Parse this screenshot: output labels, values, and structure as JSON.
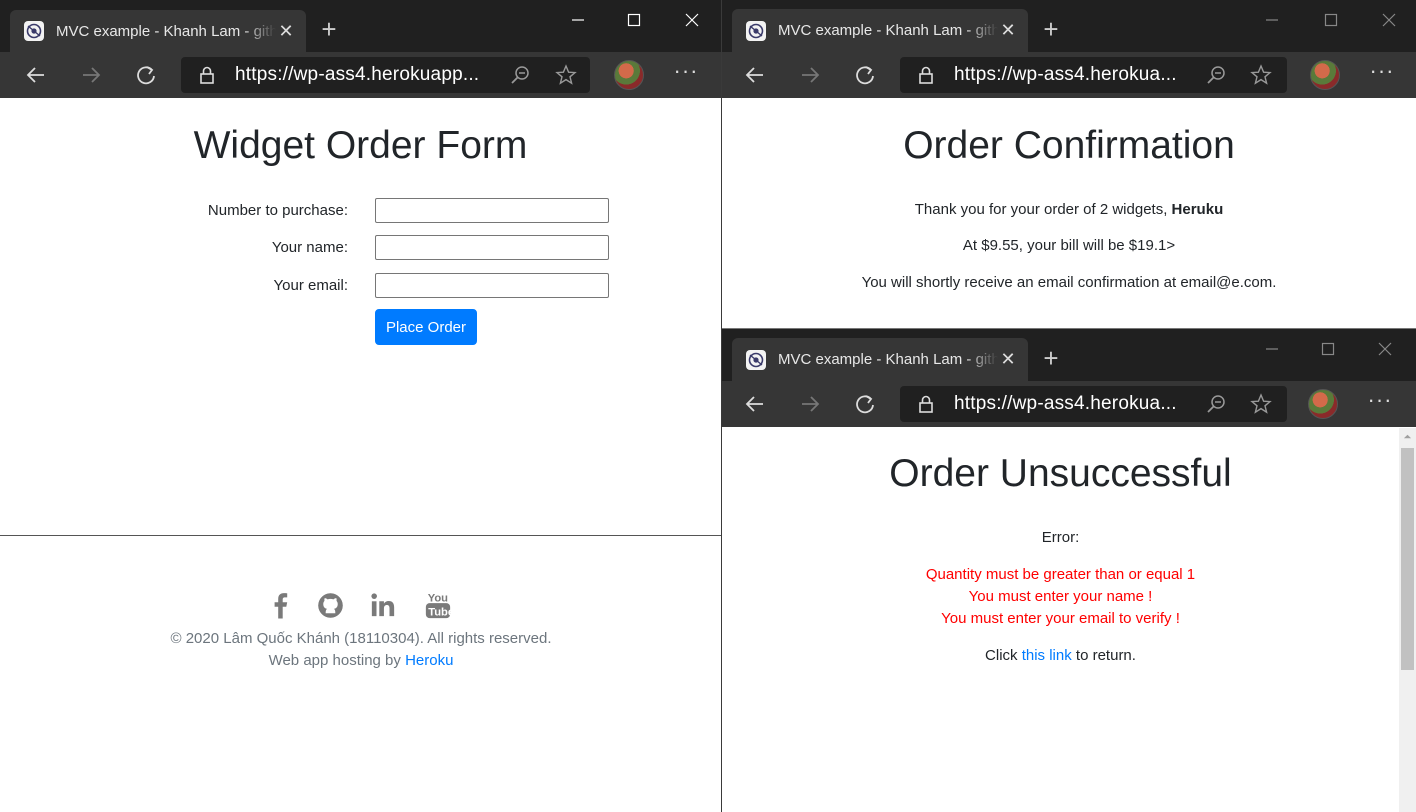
{
  "browser": {
    "tab_title": "MVC example - Khanh Lam - github",
    "url_left": "https://wp-ass4.herokuapp...",
    "url_right": "https://wp-ass4.herokua..."
  },
  "order_form": {
    "heading": "Widget Order Form",
    "fields": [
      {
        "label": "Number to purchase:",
        "value": ""
      },
      {
        "label": "Your name:",
        "value": ""
      },
      {
        "label": "Your email:",
        "value": ""
      }
    ],
    "submit_label": "Place Order"
  },
  "footer": {
    "social": [
      "facebook-icon",
      "github-icon",
      "linkedin-icon",
      "youtube-icon"
    ],
    "copyright": "© 2020 Lâm Quốc Khánh (18110304). All rights reserved.",
    "hosting_prefix": "Web app hosting by ",
    "hosting_link": "Heroku"
  },
  "confirmation": {
    "heading": "Order Confirmation",
    "thanks_prefix": "Thank you for your order of 2 widgets, ",
    "customer_name": "Heruku",
    "bill": "At $9.55, your bill will be $19.1>",
    "email_notice": "You will shortly receive an email confirmation at email@e.com."
  },
  "unsuccessful": {
    "heading": "Order Unsuccessful",
    "error_label": "Error:",
    "errors": [
      "Quantity must be greater than or equal 1",
      "You must enter your name !",
      "You must enter your email to verify !"
    ],
    "return_prefix": "Click ",
    "return_link": "this link",
    "return_suffix": " to return."
  },
  "colors": {
    "titlebar": "#202020",
    "toolbar": "#363636",
    "primary": "#007bff",
    "error": "#ff0000"
  }
}
